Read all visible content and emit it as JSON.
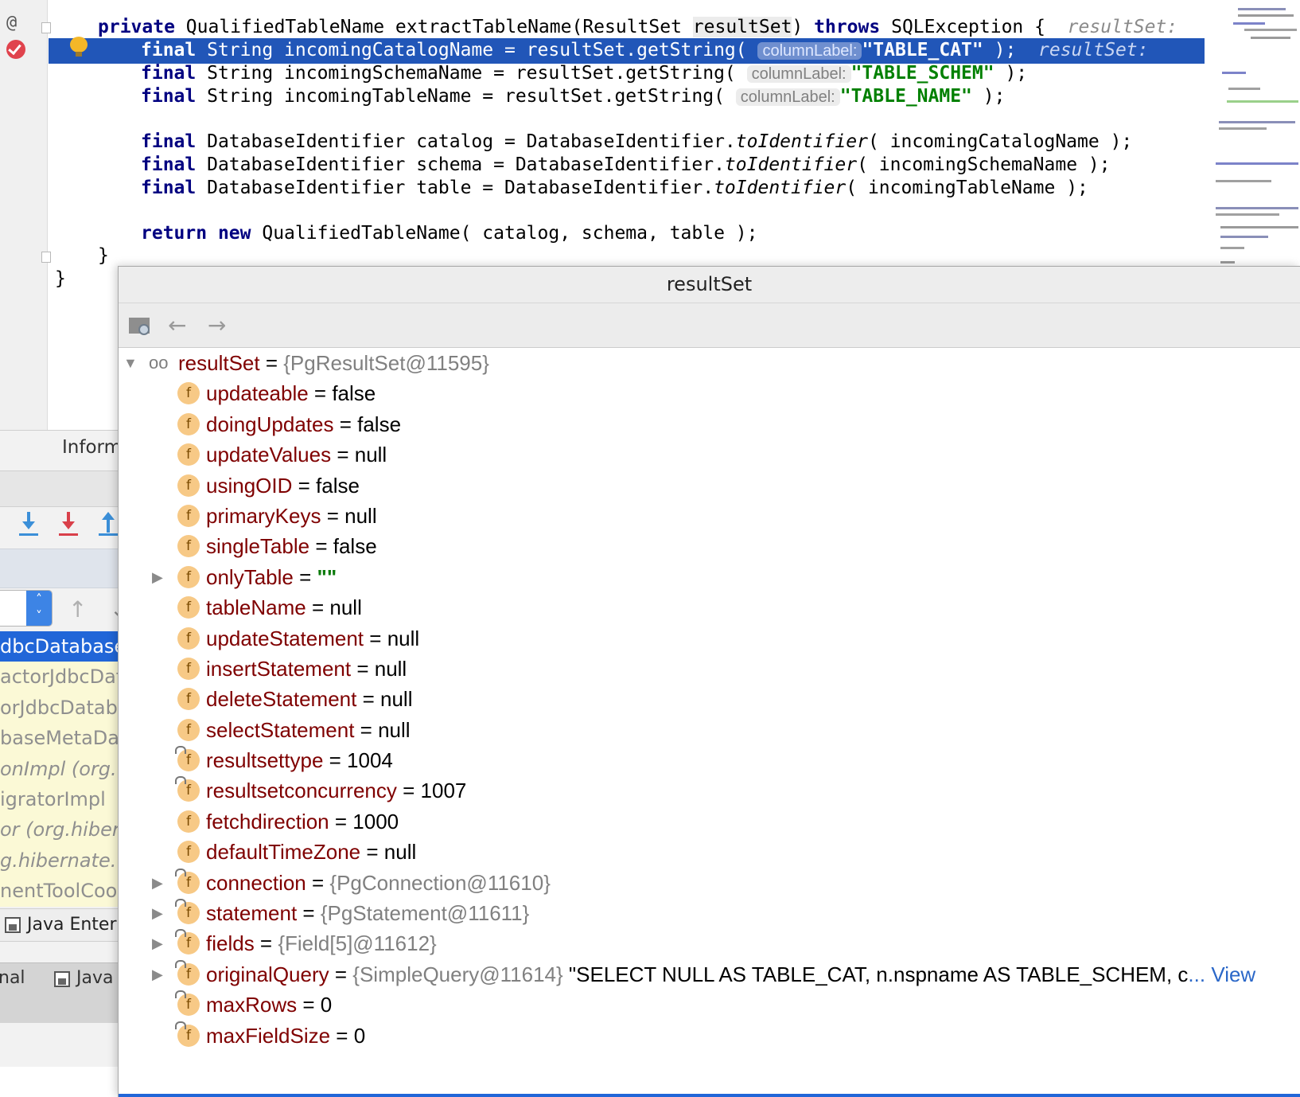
{
  "editor": {
    "method_signature": {
      "kw_private": "private",
      "type": "QualifiedTableName",
      "name": "extractTableName(",
      "param_type": "ResultSet",
      "param_name": "resultSet",
      "close_paren": ")",
      "kw_throws": "throws",
      "exception": "SQLException {",
      "inline_value": "resultSet:"
    },
    "lines": [
      {
        "kw": "final",
        "decl": " String incomingCatalogName = resultSet.getString( ",
        "hint": "columnLabel:",
        "str": "\"TABLE_CAT\"",
        "end": " );",
        "inline": "resultSet:"
      },
      {
        "kw": "final",
        "decl": " String incomingSchemaName = resultSet.getString( ",
        "hint": "columnLabel:",
        "str": "\"TABLE_SCHEM\"",
        "end": " );"
      },
      {
        "kw": "final",
        "decl": " String incomingTableName = resultSet.getString( ",
        "hint": "columnLabel:",
        "str": "\"TABLE_NAME\"",
        "end": " );"
      }
    ],
    "ident_lines": [
      {
        "kw": "final",
        "pre": " DatabaseIdentifier catalog = DatabaseIdentifier.",
        "method": "toIdentifier",
        "post": "( incomingCatalogName );"
      },
      {
        "kw": "final",
        "pre": " DatabaseIdentifier schema = DatabaseIdentifier.",
        "method": "toIdentifier",
        "post": "( incomingSchemaName );"
      },
      {
        "kw": "final",
        "pre": " DatabaseIdentifier table = DatabaseIdentifier.",
        "method": "toIdentifier",
        "post": "( incomingTableName );"
      }
    ],
    "return_line": {
      "kw_return": "return",
      "kw_new": "new",
      "rest": " QualifiedTableName( catalog, schema, table );"
    },
    "close_brace_method": "}",
    "close_brace_class": "}",
    "gutter_annotation": "@"
  },
  "left_panel": {
    "title": "Inform",
    "frames": [
      {
        "label": "dbcDatabase",
        "selected": true,
        "italic": false
      },
      {
        "label": "actorJdbcDat",
        "selected": false,
        "italic": false
      },
      {
        "label": "orJdbcDataba",
        "selected": false,
        "italic": false
      },
      {
        "label": "baseMetaDat",
        "selected": false,
        "italic": false
      },
      {
        "label": "onImpl (org.",
        "selected": false,
        "italic": true
      },
      {
        "label": "igratorImpl",
        "selected": false,
        "italic": false
      },
      {
        "label": "or (org.hiber",
        "selected": false,
        "italic": true
      },
      {
        "label": "g.hibernate.t",
        "selected": false,
        "italic": true
      },
      {
        "label": "nentToolCoo",
        "selected": false,
        "italic": false
      }
    ],
    "tab_java_enterprise": "Java Enterp",
    "tab_terminal": "nal",
    "tab_java": "Java"
  },
  "popup": {
    "title": "resultSet",
    "root": {
      "name": "resultSet",
      "eq": " = ",
      "ref": "{PgResultSet@11595}"
    },
    "fields": [
      {
        "name": "updateable",
        "value": "false",
        "kind": "val",
        "expandable": false,
        "locked": false
      },
      {
        "name": "doingUpdates",
        "value": "false",
        "kind": "val",
        "expandable": false,
        "locked": false
      },
      {
        "name": "updateValues",
        "value": "null",
        "kind": "val",
        "expandable": false,
        "locked": false
      },
      {
        "name": "usingOID",
        "value": "false",
        "kind": "val",
        "expandable": false,
        "locked": false
      },
      {
        "name": "primaryKeys",
        "value": "null",
        "kind": "val",
        "expandable": false,
        "locked": false
      },
      {
        "name": "singleTable",
        "value": "false",
        "kind": "val",
        "expandable": false,
        "locked": false
      },
      {
        "name": "onlyTable",
        "value": "\"\"",
        "kind": "str",
        "expandable": true,
        "locked": false
      },
      {
        "name": "tableName",
        "value": "null",
        "kind": "val",
        "expandable": false,
        "locked": false
      },
      {
        "name": "updateStatement",
        "value": "null",
        "kind": "val",
        "expandable": false,
        "locked": false
      },
      {
        "name": "insertStatement",
        "value": "null",
        "kind": "val",
        "expandable": false,
        "locked": false
      },
      {
        "name": "deleteStatement",
        "value": "null",
        "kind": "val",
        "expandable": false,
        "locked": false
      },
      {
        "name": "selectStatement",
        "value": "null",
        "kind": "val",
        "expandable": false,
        "locked": false
      },
      {
        "name": "resultsettype",
        "value": "1004",
        "kind": "val",
        "expandable": false,
        "locked": true
      },
      {
        "name": "resultsetconcurrency",
        "value": "1007",
        "kind": "val",
        "expandable": false,
        "locked": true
      },
      {
        "name": "fetchdirection",
        "value": "1000",
        "kind": "val",
        "expandable": false,
        "locked": false
      },
      {
        "name": "defaultTimeZone",
        "value": "null",
        "kind": "val",
        "expandable": false,
        "locked": false
      },
      {
        "name": "connection",
        "value": "{PgConnection@11610}",
        "kind": "ref",
        "expandable": true,
        "locked": true
      },
      {
        "name": "statement",
        "value": "{PgStatement@11611}",
        "kind": "ref",
        "expandable": true,
        "locked": true
      },
      {
        "name": "fields",
        "value": "{Field[5]@11612}",
        "kind": "ref",
        "expandable": true,
        "locked": true
      },
      {
        "name": "originalQuery",
        "value": "{SimpleQuery@11614}",
        "kind": "ref",
        "expandable": true,
        "locked": true,
        "extra": " \"SELECT NULL AS TABLE_CAT, n.nspname AS TABLE_SCHEM, c",
        "ellipsis": "... ",
        "link": "View"
      },
      {
        "name": "maxRows",
        "value": "0",
        "kind": "val",
        "expandable": false,
        "locked": true
      },
      {
        "name": "maxFieldSize",
        "value": "0",
        "kind": "val",
        "expandable": false,
        "locked": true
      }
    ]
  }
}
